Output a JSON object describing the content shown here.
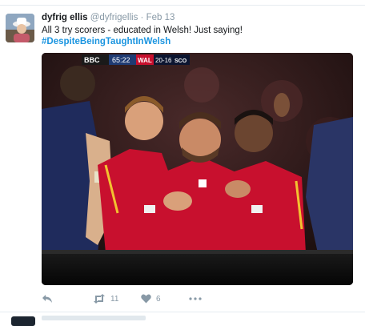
{
  "tweet": {
    "display_name": "dyfrig ellis",
    "handle": "@dyfrigellis",
    "separator": "·",
    "timestamp": "Feb 13",
    "text": "All 3 try scorers - educated in Welsh!  Just saying!",
    "hashtag": "#DespiteBeingTaughtInWelsh"
  },
  "media": {
    "broadcaster": "BBC",
    "clock": "65:22",
    "team_home": "WAL",
    "score": "20-16",
    "team_away": "SCO"
  },
  "actions": {
    "reply_icon": "reply-icon",
    "retweet_icon": "retweet-icon",
    "retweet_count": "11",
    "like_icon": "heart-icon",
    "like_count": "6",
    "more_icon": "more-icon"
  },
  "colors": {
    "link": "#1b95e0",
    "muted": "#8899a6",
    "wales_red": "#c8102e",
    "scotland_navy": "#1f2b5c"
  }
}
